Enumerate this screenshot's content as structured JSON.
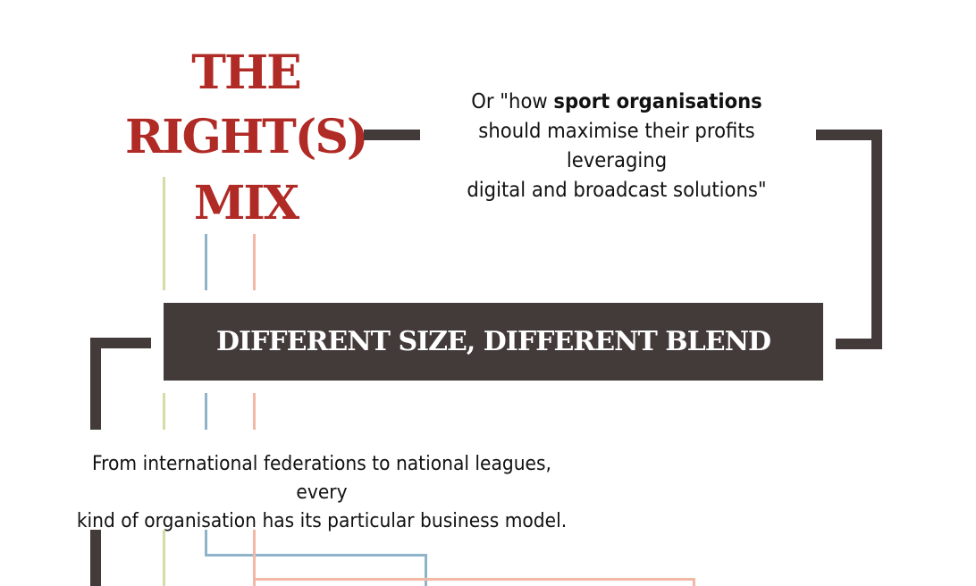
{
  "title": {
    "line1": "THE",
    "line2": "RIGHT(S)",
    "line3": "MIX"
  },
  "subtitle": {
    "prefix": "Or \"how ",
    "bold": "sport organisations",
    "line2": "should maximise their profits leveraging",
    "line3": "digital and broadcast solutions\""
  },
  "banner": {
    "label": "DIFFERENT SIZE, DIFFERENT BLEND"
  },
  "description": {
    "line1": "From international federations to national leagues, every",
    "line2": "kind of organisation has its particular business model."
  },
  "colors": {
    "title_red": "#b02a26",
    "connector_dark": "#433a3a",
    "strand_green": "#d5dca6",
    "strand_blue": "#8fb3c9",
    "strand_salmon": "#f2b7a5"
  }
}
